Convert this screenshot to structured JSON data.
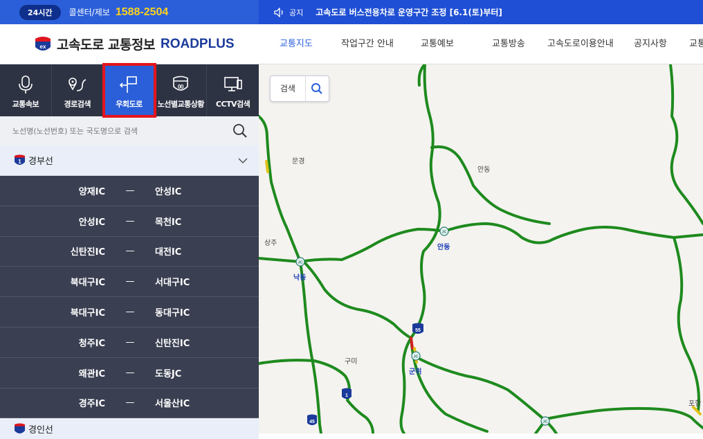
{
  "topbar": {
    "hours_badge": "24시간",
    "callcenter_label": "콜센터/제보",
    "phone": "1588-2504",
    "notice_label": "공지",
    "notice_text": "고속도로 버스전용차로 운영구간 조정 [6.1(토)부터]"
  },
  "header": {
    "logo_text": "고속도로 교통정보",
    "logo_brand": "ROADPLUS",
    "logo_badge": "ex",
    "nav": [
      {
        "label": "교통지도",
        "active": true
      },
      {
        "label": "작업구간 안내",
        "active": false
      },
      {
        "label": "교통예보",
        "active": false
      },
      {
        "label": "교통방송",
        "active": false
      },
      {
        "label": "고속도로이용안내",
        "active": false
      },
      {
        "label": "공지사항",
        "active": false
      },
      {
        "label": "교통",
        "active": false
      }
    ]
  },
  "sidebar": {
    "tabs": [
      {
        "label": "교통속보",
        "icon": "microphone-icon",
        "active": false
      },
      {
        "label": "경로검색",
        "icon": "route-pin-icon",
        "active": false
      },
      {
        "label": "우회도로",
        "icon": "detour-sign-icon",
        "active": true
      },
      {
        "label": "노선별교통상황",
        "icon": "highway-shield-icon",
        "active": false
      },
      {
        "label": "CCTV검색",
        "icon": "cctv-monitor-icon",
        "active": false
      }
    ],
    "search_placeholder": "노선명(노선번호) 또는 국도명으로 검색",
    "route": {
      "number": "1",
      "name": "경부선"
    },
    "segments": [
      {
        "from": "양재IC",
        "dash": "—",
        "to": "안성IC"
      },
      {
        "from": "안성IC",
        "dash": "—",
        "to": "목천IC"
      },
      {
        "from": "신탄진IC",
        "dash": "—",
        "to": "대전IC"
      },
      {
        "from": "북대구IC",
        "dash": "—",
        "to": "서대구IC"
      },
      {
        "from": "북대구IC",
        "dash": "—",
        "to": "동대구IC"
      },
      {
        "from": "청주IC",
        "dash": "—",
        "to": "신탄진IC"
      },
      {
        "from": "왜관IC",
        "dash": "—",
        "to": "도동JC"
      },
      {
        "from": "경주IC",
        "dash": "—",
        "to": "서울산IC"
      }
    ],
    "next_route_name": "경인선"
  },
  "map": {
    "search_label": "검색",
    "places": [
      "문경",
      "안동",
      "상주",
      "안동",
      "낙동",
      "구미",
      "군위",
      "포항"
    ],
    "route_badges": [
      "55",
      "1",
      "45"
    ],
    "junction_label": "JC",
    "colors": {
      "flow_good": "#1e8a1e",
      "flow_slow": "#e0c21a",
      "flow_jam": "#d32020"
    }
  }
}
